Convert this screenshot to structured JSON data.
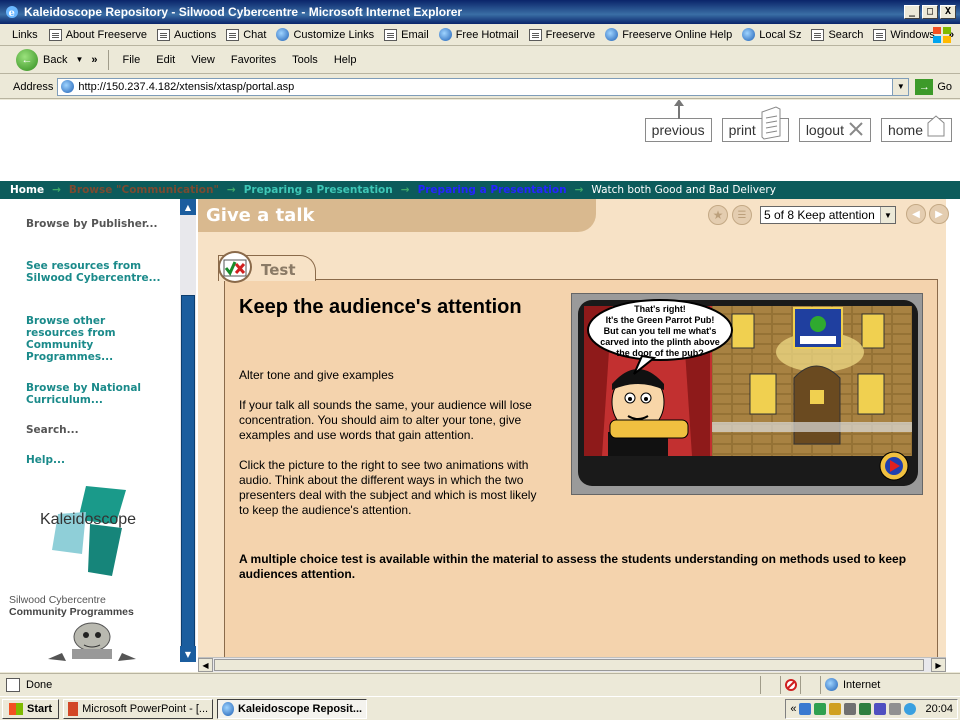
{
  "window": {
    "title": "Kaleidoscope Repository - Silwood Cybercentre - Microsoft Internet Explorer",
    "minimize": "_",
    "maximize": "□",
    "close": "X"
  },
  "links_bar": {
    "label": "Links",
    "items": [
      "About Freeserve",
      "Auctions",
      "Chat",
      "Customize Links",
      "Email",
      "Free Hotmail",
      "Freeserve",
      "Freeserve Online Help",
      "Local Sz",
      "Search",
      "Windows"
    ],
    "overflow": "»"
  },
  "toolbar": {
    "back_label": "Back",
    "forward": "»",
    "menus": [
      "File",
      "Edit",
      "View",
      "Favorites",
      "Tools",
      "Help"
    ]
  },
  "address_bar": {
    "label": "Address",
    "url": "http://150.237.4.182/xtensis/xtasp/portal.asp",
    "go_label": "Go"
  },
  "top_nav": {
    "previous": "previous",
    "print": "print",
    "logout": "logout",
    "home": "home"
  },
  "breadcrumb": {
    "home": "Home",
    "browse": "Browse \"Communication\"",
    "prep1": "Preparing a Presentation",
    "prep2": "Preparing a Presentation",
    "current": "Watch both Good and Bad Delivery",
    "separator": "→"
  },
  "sidebar": {
    "browse_publisher": "Browse by Publisher...",
    "see_resources": "See resources from Silwood Cybercentre...",
    "browse_other": "Browse other resources from Community Programmes...",
    "browse_national": "Browse by National Curriculum...",
    "search": "Search...",
    "help": "Help...",
    "logo_text": "Kaleidoscope",
    "org_line1": "Silwood Cybercentre",
    "org_line2": "Community Programmes"
  },
  "lesson": {
    "heading": "Give a talk",
    "step_select": "5 of 8 Keep attention",
    "tab_label": "Test",
    "title": "Keep the audience's attention",
    "subtitle": "Alter tone and give examples",
    "para1": "If your talk all sounds the same, your audience will lose concentration. You should aim to alter your tone, give examples and use words that gain attention.",
    "para2": "Click the picture to the right to see two animations with audio. Think about the different ways in which the two presenters deal with the subject and which is most likely to keep the audience's attention.",
    "bold_para": "A multiple choice test is available within the material to assess the students understanding on methods used to keep audiences attention.",
    "speech_bubble": [
      "That's right!",
      "It's the Green Parrot Pub!",
      "But can you tell me what's",
      "carved into the plinth above",
      "the door of the pub?"
    ]
  },
  "status_bar": {
    "status": "Done",
    "zone": "Internet"
  },
  "taskbar": {
    "start": "Start",
    "tasks": [
      "Microsoft PowerPoint - [...",
      "Kaleidoscope Reposit..."
    ],
    "tray_overflow": "«",
    "clock": "20:04"
  },
  "colors": {
    "breadcrumb_bg": "#0c5b5b",
    "frame_bg": "#f7e2c6",
    "panel_bg": "#f4d3ad",
    "sidebar_link": "#1a8a8a",
    "scroll_blue": "#1b5d9e"
  }
}
